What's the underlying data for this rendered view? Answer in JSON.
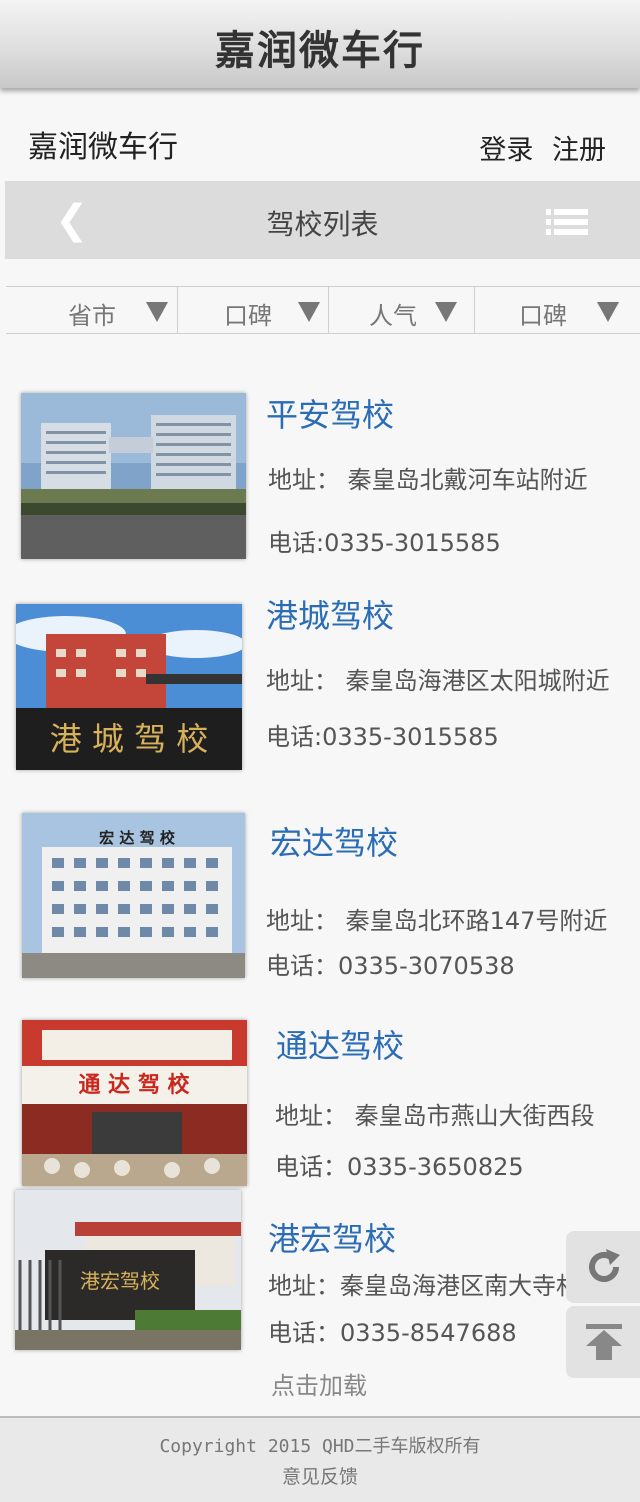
{
  "app": {
    "title": "嘉润微车行"
  },
  "header": {
    "site_name": "嘉润微车行",
    "login": "登录",
    "register": "注册"
  },
  "nav": {
    "back_icon": "chevron-left-icon",
    "title": "驾校列表",
    "menu_icon": "list-menu-icon"
  },
  "filters": [
    {
      "label": "省市"
    },
    {
      "label": "口碑"
    },
    {
      "label": "人气"
    },
    {
      "label": "口碑"
    }
  ],
  "schools": [
    {
      "name": "平安驾校",
      "address": "地址：  秦皇岛北戴河车站附近",
      "phone": "电话:0335-3015585"
    },
    {
      "name": "港城驾校",
      "address": "地址：  秦皇岛海港区太阳城附近",
      "phone": "电话:0335-3015585"
    },
    {
      "name": "宏达驾校",
      "address": "地址：  秦皇岛北环路147号附近",
      "phone": "电话：0335-3070538"
    },
    {
      "name": "通达驾校",
      "address": "地址：  秦皇岛市燕山大街西段",
      "phone": "电话：0335-3650825"
    },
    {
      "name": "港宏驾校",
      "address": "地址：秦皇岛海港区南大寺村",
      "phone": "电话：0335-8547688"
    }
  ],
  "photo_signs": {
    "gangcheng": "港 城 驾 校",
    "hongda": "宏  达  驾  校",
    "tongda": "通  达  驾  校",
    "ganghong": "港宏驾校"
  },
  "load_more": "点击加载",
  "side_buttons": {
    "refresh_icon": "refresh-icon",
    "top_icon": "back-to-top-icon"
  },
  "footer": {
    "copyright": "Copyright  2015 QHD二手车版权所有",
    "feedback": "意见反馈"
  },
  "colors": {
    "link_blue": "#2a6cb5",
    "nav_gray": "#dcdcdc",
    "page_bg": "#f7f7f7"
  }
}
